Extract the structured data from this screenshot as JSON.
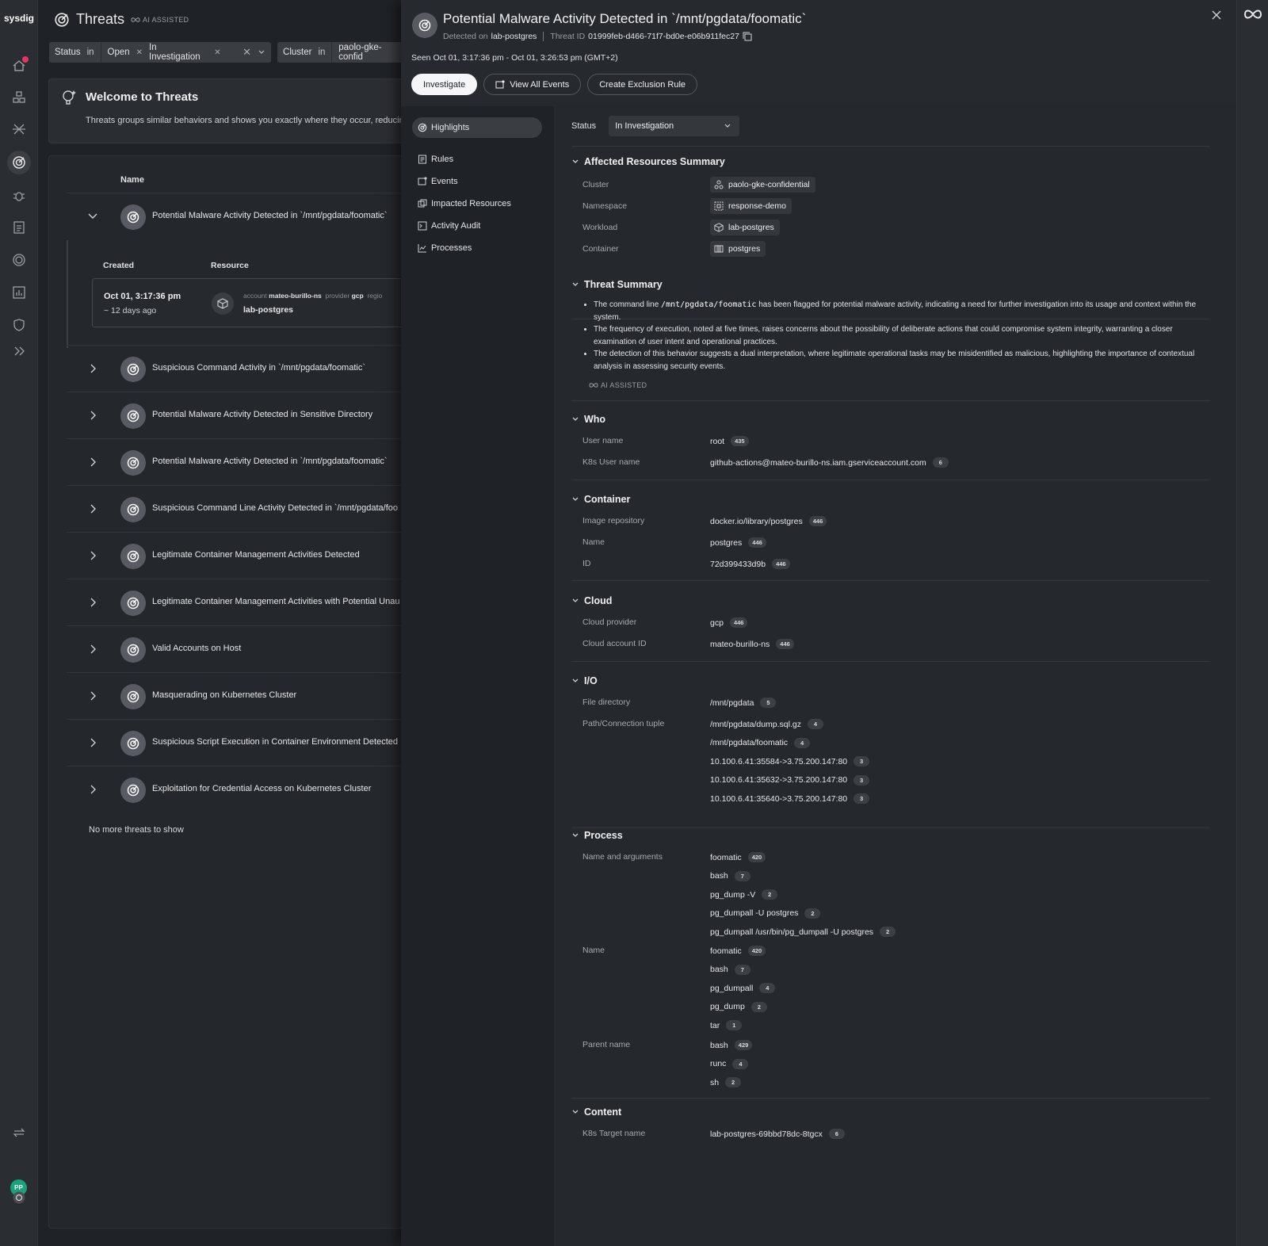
{
  "nav": {
    "logo": "sysdig",
    "avatar": "PP"
  },
  "main": {
    "title": "Threats",
    "ai_label": "AI ASSISTED",
    "filters": [
      {
        "key": "Status",
        "op": "in",
        "values": [
          "Open",
          "In Investigation"
        ]
      },
      {
        "key": "Cluster",
        "op": "in",
        "values": [
          "paolo-gke-confid"
        ]
      }
    ],
    "welcome": {
      "title": "Welcome to Threats",
      "body": "Threats groups similar behaviors and shows you exactly where they occur, reducin"
    },
    "column_name": "Name",
    "expanded": {
      "threat": "Potential Malware Activity Detected in `/mnt/pgdata/foomatic`",
      "col_created": "Created",
      "col_resource": "Resource",
      "created": "Oct 01, 3:17:36 pm",
      "ago": "~ 12 days ago",
      "account_label": "account",
      "account": "mateo-burillo-ns",
      "provider_label": "provider",
      "provider": "gcp",
      "region_label": "regio",
      "workload": "lab-postgres"
    },
    "threats": [
      "Suspicious Command Activity in `/mnt/pgdata/foomatic`",
      "Potential Malware Activity Detected in Sensitive Directory",
      "Potential Malware Activity Detected in `/mnt/pgdata/foomatic`",
      "Suspicious Command Line Activity Detected in `/mnt/pgdata/foo",
      "Legitimate Container Management Activities Detected",
      "Legitimate Container Management Activities with Potential Unau",
      "Valid Accounts on Host",
      "Masquerading on Kubernetes Cluster",
      "Suspicious Script Execution in Container Environment Detected",
      "Exploitation for Credential Access on Kubernetes Cluster"
    ],
    "no_more": "No more threats to show"
  },
  "drawer": {
    "title": "Potential Malware Activity Detected in `/mnt/pgdata/foomatic`",
    "detected_label": "Detected on",
    "detected_on": "lab-postgres",
    "threat_id_label": "Threat ID",
    "threat_id": "01999feb-d466-71f7-bd0e-e06b911fec27",
    "seen": "Seen Oct 01, 3:17:36 pm - Oct 01, 3:26:53 pm (GMT+2)",
    "buttons": {
      "investigate": "Investigate",
      "view_events": "View All Events",
      "exclusion": "Create Exclusion Rule"
    },
    "sidebar": [
      "Highlights",
      "Rules",
      "Events",
      "Impacted Resources",
      "Activity Audit",
      "Processes"
    ],
    "status_label": "Status",
    "status_value": "In Investigation",
    "affected": {
      "title": "Affected Resources Summary",
      "rows": [
        {
          "k": "Cluster",
          "v": "paolo-gke-confidential"
        },
        {
          "k": "Namespace",
          "v": "response-demo"
        },
        {
          "k": "Workload",
          "v": "lab-postgres"
        },
        {
          "k": "Container",
          "v": "postgres"
        }
      ]
    },
    "summary": {
      "title": "Threat Summary",
      "b1_pre": "The command line ",
      "b1_code": "/mnt/pgdata/foomatic",
      "b1_post": " has been flagged for potential malware activity, indicating a need for further investigation into its usage and context within the system.",
      "b2": "The frequency of execution, noted at five times, raises concerns about the possibility of deliberate actions that could compromise system integrity, warranting a closer examination of user intent and operational practices.",
      "b3": "The detection of this behavior suggests a dual interpretation, where legitimate operational tasks may be misidentified as malicious, highlighting the importance of contextual analysis in assessing security events.",
      "ai": "AI ASSISTED"
    },
    "who": {
      "title": "Who",
      "rows": [
        {
          "k": "User name",
          "v": "root",
          "c": "435"
        },
        {
          "k": "K8s User name",
          "v": "github-actions@mateo-burillo-ns.iam.gserviceaccount.com",
          "c": "6"
        }
      ]
    },
    "container": {
      "title": "Container",
      "rows": [
        {
          "k": "Image repository",
          "v": "docker.io/library/postgres",
          "c": "446"
        },
        {
          "k": "Name",
          "v": "postgres",
          "c": "446"
        },
        {
          "k": "ID",
          "v": "72d399433d9b",
          "c": "446"
        }
      ]
    },
    "cloud": {
      "title": "Cloud",
      "rows": [
        {
          "k": "Cloud provider",
          "v": "gcp",
          "c": "446"
        },
        {
          "k": "Cloud account ID",
          "v": "mateo-burillo-ns",
          "c": "446"
        }
      ]
    },
    "io": {
      "title": "I/O",
      "file_dir_label": "File directory",
      "file_dir": {
        "v": "/mnt/pgdata",
        "c": "5"
      },
      "path_label": "Path/Connection tuple",
      "paths": [
        {
          "v": "/mnt/pgdata/dump.sql.gz",
          "c": "4"
        },
        {
          "v": "/mnt/pgdata/foomatic",
          "c": "4"
        },
        {
          "v": "10.100.6.41:35584->3.75.200.147:80",
          "c": "3"
        },
        {
          "v": "10.100.6.41:35632->3.75.200.147:80",
          "c": "3"
        },
        {
          "v": "10.100.6.41:35640->3.75.200.147:80",
          "c": "3"
        }
      ]
    },
    "process": {
      "title": "Process",
      "args_label": "Name and arguments",
      "args": [
        {
          "v": "foomatic",
          "c": "420"
        },
        {
          "v": "bash",
          "c": "7"
        },
        {
          "v": "pg_dump -V",
          "c": "2"
        },
        {
          "v": "pg_dumpall -U postgres",
          "c": "2"
        },
        {
          "v": "pg_dumpall /usr/bin/pg_dumpall -U postgres",
          "c": "2"
        }
      ],
      "name_label": "Name",
      "names": [
        {
          "v": "foomatic",
          "c": "420"
        },
        {
          "v": "bash",
          "c": "7"
        },
        {
          "v": "pg_dumpall",
          "c": "4"
        },
        {
          "v": "pg_dump",
          "c": "2"
        },
        {
          "v": "tar",
          "c": "1"
        }
      ],
      "parent_label": "Parent name",
      "parents": [
        {
          "v": "bash",
          "c": "429"
        },
        {
          "v": "runc",
          "c": "4"
        },
        {
          "v": "sh",
          "c": "2"
        }
      ]
    },
    "content": {
      "title": "Content",
      "k": "K8s Target name",
      "v": "lab-postgres-69bbd78dc-8tgcx",
      "c": "6"
    }
  }
}
